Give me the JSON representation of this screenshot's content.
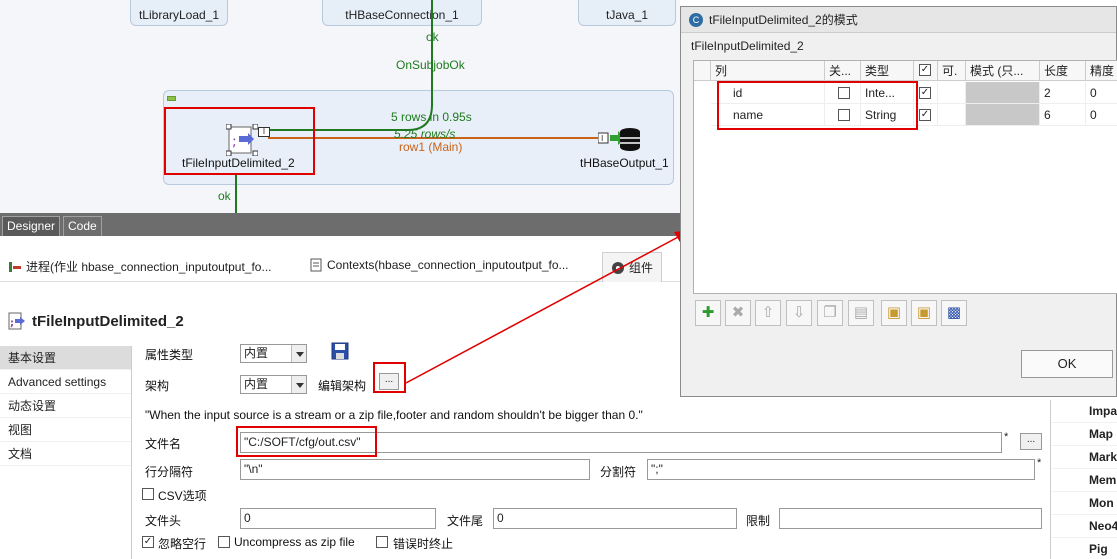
{
  "canvas": {
    "top_nodes": [
      "tLibraryLoad_1",
      "tHBaseConnection_1",
      "tJava_1"
    ],
    "flow_ok_top": "ok",
    "flow_onsubjobok": "OnSubjobOk",
    "flow_stats_rows": "5 rows in 0.95s",
    "flow_stats_rate": "5.25 rows/s",
    "flow_row_label": "row1 (Main)",
    "source_node": "tFileInputDelimited_2",
    "target_node": "tHBaseOutput_1",
    "flow_ok_bottom": "ok"
  },
  "design_tabs": [
    "Designer",
    "Code"
  ],
  "views": {
    "tabs": [
      {
        "label": "进程(作业 hbase_connection_inputoutput_fo..."
      },
      {
        "label": "Contexts(hbase_connection_inputoutput_fo..."
      },
      {
        "label": "组件"
      }
    ]
  },
  "component": {
    "title": "tFileInputDelimited_2",
    "nav": [
      "基本设置",
      "Advanced settings",
      "动态设置",
      "视图",
      "文档"
    ],
    "property_type_label": "属性类型",
    "property_type_value": "内置",
    "schema_label": "架构",
    "schema_value": "内置",
    "edit_schema_label": "编辑架构",
    "edit_schema_button": "...",
    "note": "\"When the input source is a stream or a zip file,footer and random shouldn't be bigger than 0.\"",
    "filename_label": "文件名",
    "filename_value": "\"C:/SOFT/cfg/out.csv\"",
    "browse_button": "...",
    "row_sep_label": "行分隔符",
    "row_sep_value": "\"\\n\"",
    "field_sep_label": "分割符",
    "field_sep_value": "\";\"",
    "csv_label": "CSV选项",
    "header_label": "文件头",
    "header_value": "0",
    "footer_label": "文件尾",
    "footer_value": "0",
    "limit_label": "限制",
    "limit_value": "",
    "skip_empty_label": "忽略空行",
    "uncompress_label": "Uncompress as zip file",
    "die_on_error_label": "错误时终止",
    "required_mark": "*"
  },
  "palette": [
    "Impa",
    "Map",
    "Mark",
    "Mem",
    "Mon",
    "Neo4",
    "Pig"
  ],
  "dialog": {
    "title": "tFileInputDelimited_2的模式",
    "logo": "C",
    "subtitle": "tFileInputDelimited_2",
    "columns": [
      "列",
      "关...",
      "类型",
      "",
      "可.",
      "模式 (只...",
      "长度",
      "精度"
    ],
    "rows": [
      {
        "name": "id",
        "type": "Inte...",
        "length": "2",
        "precision": "0"
      },
      {
        "name": "name",
        "type": "String",
        "length": "6",
        "precision": "0"
      }
    ],
    "ok_label": "OK"
  },
  "colors": {
    "highlight": "#e00000",
    "flow_green": "#1f7a1f",
    "flow_orange": "#c8641a"
  }
}
